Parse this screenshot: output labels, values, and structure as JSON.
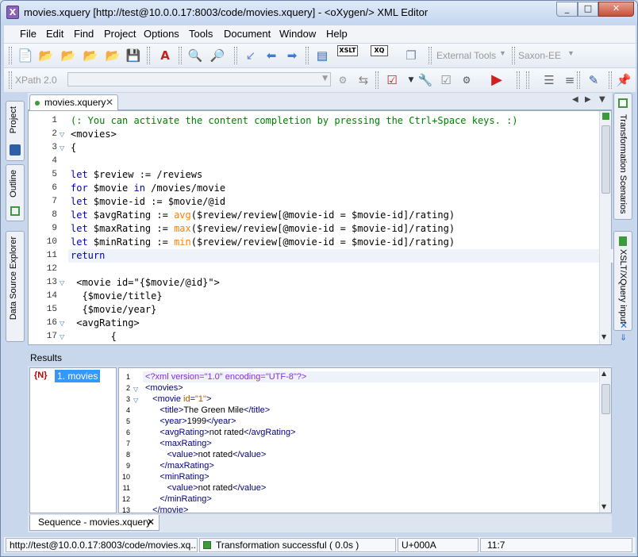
{
  "window": {
    "title": "movies.xquery [http://test@10.0.0.17:8003/code/movies.xquery] - <oXygen/> XML Editor",
    "app_icon": "oxygen-x-icon",
    "controls": [
      "_",
      "□",
      "✕"
    ]
  },
  "menu": [
    "File",
    "Edit",
    "Find",
    "Project",
    "Options",
    "Tools",
    "Document",
    "Window",
    "Help"
  ],
  "toolbar": {
    "external_tools": "External Tools",
    "saxon": "Saxon-EE",
    "xpath_version": "XPath 2.0",
    "xslt_label": "XSLT",
    "xq_label": "XQ"
  },
  "side_left_tabs": [
    "Project",
    "Outline",
    "Data Source Explorer"
  ],
  "side_right_tabs": [
    "Transformation Scenarios",
    "XSLT/XQuery input"
  ],
  "editor": {
    "tab": "movies.xquery",
    "lines": [
      {
        "n": "1",
        "fold": "",
        "segs": [
          {
            "t": "(: You can activate the content completion by pressing the Ctrl+Space keys. :)",
            "c": "cm"
          }
        ]
      },
      {
        "n": "2",
        "fold": "▽",
        "segs": [
          {
            "t": "<movies>",
            "c": "tx"
          }
        ]
      },
      {
        "n": "3",
        "fold": "▽",
        "segs": [
          {
            "t": "{",
            "c": "tx"
          }
        ]
      },
      {
        "n": "4",
        "fold": "",
        "segs": []
      },
      {
        "n": "5",
        "fold": "",
        "segs": [
          {
            "t": "let",
            "c": "kw"
          },
          {
            "t": " $review := /reviews",
            "c": "tx"
          }
        ]
      },
      {
        "n": "6",
        "fold": "",
        "segs": [
          {
            "t": "for",
            "c": "kw"
          },
          {
            "t": " $movie ",
            "c": "tx"
          },
          {
            "t": "in",
            "c": "kw"
          },
          {
            "t": " /movies/movie",
            "c": "tx"
          }
        ]
      },
      {
        "n": "7",
        "fold": "",
        "segs": [
          {
            "t": "let",
            "c": "kw"
          },
          {
            "t": " $movie-id := $movie/@id",
            "c": "tx"
          }
        ]
      },
      {
        "n": "8",
        "fold": "",
        "segs": [
          {
            "t": "let",
            "c": "kw"
          },
          {
            "t": " $avgRating := ",
            "c": "tx"
          },
          {
            "t": "avg",
            "c": "fn"
          },
          {
            "t": "($review/review[@movie-id = $movie-id]/rating)",
            "c": "tx"
          }
        ]
      },
      {
        "n": "9",
        "fold": "",
        "segs": [
          {
            "t": "let",
            "c": "kw"
          },
          {
            "t": " $maxRating := ",
            "c": "tx"
          },
          {
            "t": "max",
            "c": "fn"
          },
          {
            "t": "($review/review[@movie-id = $movie-id]/rating)",
            "c": "tx"
          }
        ]
      },
      {
        "n": "10",
        "fold": "",
        "segs": [
          {
            "t": "let",
            "c": "kw"
          },
          {
            "t": " $minRating := ",
            "c": "tx"
          },
          {
            "t": "min",
            "c": "fn"
          },
          {
            "t": "($review/review[@movie-id = $movie-id]/rating)",
            "c": "tx"
          }
        ]
      },
      {
        "n": "11",
        "fold": "",
        "segs": [
          {
            "t": "return",
            "c": "kw"
          }
        ]
      },
      {
        "n": "12",
        "fold": "",
        "segs": []
      },
      {
        "n": "13",
        "fold": "▽",
        "segs": [
          {
            "t": " <movie id=\"{$movie/@id}\">",
            "c": "tx"
          }
        ]
      },
      {
        "n": "14",
        "fold": "",
        "segs": [
          {
            "t": "  {$movie/title}",
            "c": "tx"
          }
        ]
      },
      {
        "n": "15",
        "fold": "",
        "segs": [
          {
            "t": "  {$movie/year}",
            "c": "tx"
          }
        ]
      },
      {
        "n": "16",
        "fold": "▽",
        "segs": [
          {
            "t": " <avgRating>",
            "c": "tx"
          }
        ]
      },
      {
        "n": "17",
        "fold": "▽",
        "segs": [
          {
            "t": "       {",
            "c": "tx"
          }
        ]
      }
    ]
  },
  "results": {
    "label": "Results",
    "badge": "{N}",
    "item": "1. movies",
    "lines": [
      {
        "n": "1",
        "fold": "",
        "segs": [
          {
            "t": "<?xml version=\"1.0\" encoding=\"UTF-8\"?>",
            "c": "pi"
          }
        ]
      },
      {
        "n": "2",
        "fold": "▽",
        "segs": [
          {
            "t": "<movies>",
            "c": "tg"
          }
        ]
      },
      {
        "n": "3",
        "fold": "▽",
        "segs": [
          {
            "t": "   <movie ",
            "c": "tg"
          },
          {
            "t": "id",
            "c": "at"
          },
          {
            "t": "=",
            "c": "tg"
          },
          {
            "t": "\"1\"",
            "c": "at"
          },
          {
            "t": ">",
            "c": "tg"
          }
        ]
      },
      {
        "n": "4",
        "fold": "",
        "segs": [
          {
            "t": "      <title>",
            "c": "tg"
          },
          {
            "t": "The Green Mile",
            "c": "tx"
          },
          {
            "t": "</title>",
            "c": "tg"
          }
        ]
      },
      {
        "n": "5",
        "fold": "",
        "segs": [
          {
            "t": "      <year>",
            "c": "tg"
          },
          {
            "t": "1999",
            "c": "tx"
          },
          {
            "t": "</year>",
            "c": "tg"
          }
        ]
      },
      {
        "n": "6",
        "fold": "",
        "segs": [
          {
            "t": "      <avgRating>",
            "c": "tg"
          },
          {
            "t": "not rated",
            "c": "tx"
          },
          {
            "t": "</avgRating>",
            "c": "tg"
          }
        ]
      },
      {
        "n": "7",
        "fold": "",
        "segs": [
          {
            "t": "      <maxRating>",
            "c": "tg"
          }
        ]
      },
      {
        "n": "8",
        "fold": "",
        "segs": [
          {
            "t": "         <value>",
            "c": "tg"
          },
          {
            "t": "not rated",
            "c": "tx"
          },
          {
            "t": "</value>",
            "c": "tg"
          }
        ]
      },
      {
        "n": "9",
        "fold": "",
        "segs": [
          {
            "t": "      </maxRating>",
            "c": "tg"
          }
        ]
      },
      {
        "n": "10",
        "fold": "",
        "segs": [
          {
            "t": "      <minRating>",
            "c": "tg"
          }
        ]
      },
      {
        "n": "11",
        "fold": "",
        "segs": [
          {
            "t": "         <value>",
            "c": "tg"
          },
          {
            "t": "not rated",
            "c": "tx"
          },
          {
            "t": "</value>",
            "c": "tg"
          }
        ]
      },
      {
        "n": "12",
        "fold": "",
        "segs": [
          {
            "t": "      </minRating>",
            "c": "tg"
          }
        ]
      },
      {
        "n": "13",
        "fold": "",
        "segs": [
          {
            "t": "   </movie>",
            "c": "tg"
          }
        ]
      }
    ]
  },
  "bottom_tab": "Sequence - movies.xquery",
  "status": {
    "url": "http://test@10.0.0.17:8003/code/movies.xq...",
    "message": "Transformation successful  ( 0.0s )",
    "char": "U+000A",
    "pos": "11:7"
  },
  "colors": {
    "keyword": "#0000c0",
    "comment": "#008000",
    "function": "#ff7f00",
    "tag": "#000080",
    "attribute": "#aa5500",
    "selection": "#3399ff",
    "success": "#3c9a3c"
  }
}
